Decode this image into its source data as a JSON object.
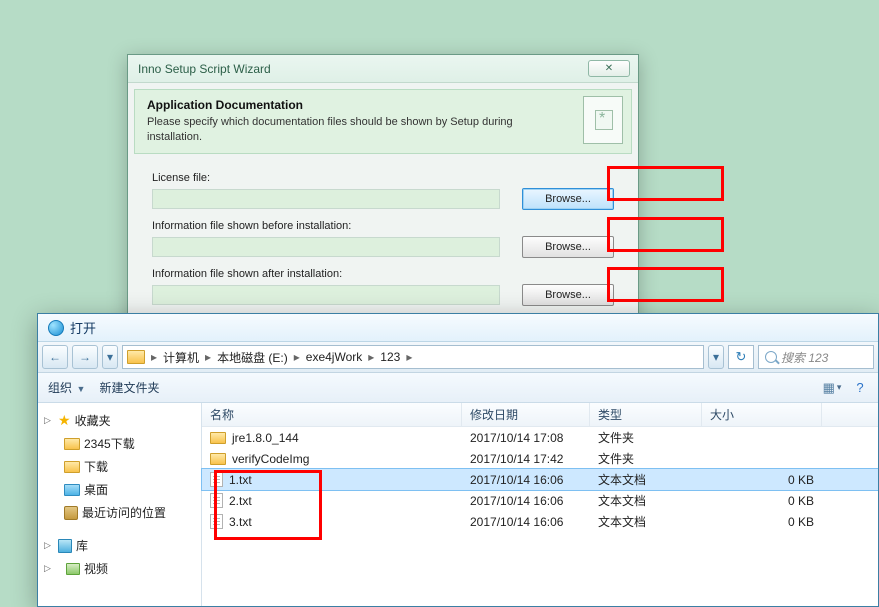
{
  "wizard": {
    "title": "Inno Setup Script Wizard",
    "header_title": "Application Documentation",
    "header_sub": "Please specify which documentation files should be shown by Setup during installation.",
    "fields": {
      "license_label": "License file:",
      "before_label": "Information file shown before installation:",
      "after_label": "Information file shown after installation:"
    },
    "browse_label": "Browse..."
  },
  "open": {
    "title": "打开",
    "breadcrumb": [
      "计算机",
      "本地磁盘 (E:)",
      "exe4jWork",
      "123"
    ],
    "search_placeholder": "搜索 123",
    "toolbar": {
      "organize": "组织",
      "newfolder": "新建文件夹"
    },
    "sidebar": {
      "favorites": "收藏夹",
      "dl2345": "2345下载",
      "downloads": "下载",
      "desktop": "桌面",
      "recent": "最近访问的位置",
      "library": "库",
      "videos": "视频"
    },
    "columns": {
      "name": "名称",
      "date": "修改日期",
      "type": "类型",
      "size": "大小"
    },
    "rows": [
      {
        "name": "jre1.8.0_144",
        "date": "2017/10/14 17:08",
        "type": "文件夹",
        "size": "",
        "kind": "folder"
      },
      {
        "name": "verifyCodeImg",
        "date": "2017/10/14 17:42",
        "type": "文件夹",
        "size": "",
        "kind": "folder"
      },
      {
        "name": "1.txt",
        "date": "2017/10/14 16:06",
        "type": "文本文档",
        "size": "0 KB",
        "kind": "file",
        "selected": true
      },
      {
        "name": "2.txt",
        "date": "2017/10/14 16:06",
        "type": "文本文档",
        "size": "0 KB",
        "kind": "file"
      },
      {
        "name": "3.txt",
        "date": "2017/10/14 16:06",
        "type": "文本文档",
        "size": "0 KB",
        "kind": "file"
      }
    ]
  }
}
